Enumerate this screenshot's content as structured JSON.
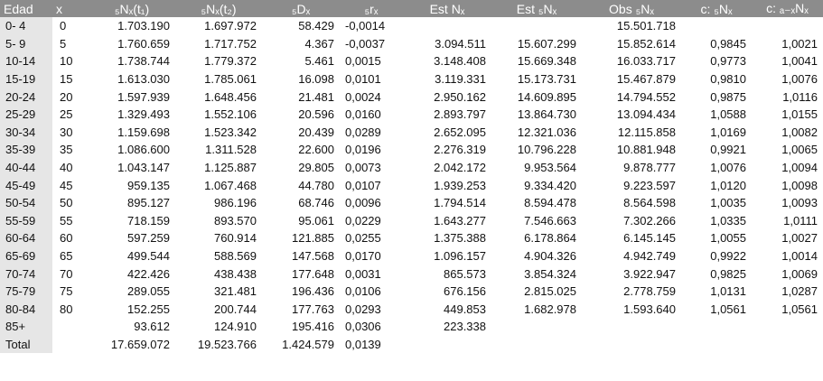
{
  "headers": [
    "Edad",
    "x",
    "₅Nₓ(t₁)",
    "₅Nₓ(t₂)",
    "₅Dₓ",
    "₅rₓ",
    "Est Nₓ",
    "Est ₅Nₓ",
    "Obs ₅Nₓ",
    "c: ₅Nₓ",
    "c: ₐ₋ₓNₓ"
  ],
  "colors": {
    "header_bg": "#8c8c8c",
    "header_text": "#ffffff",
    "label_col_bg": "#e6e6e6",
    "cell_bg": "#ffffff"
  },
  "rows": [
    [
      "0- 4",
      "0",
      "1.703.190",
      "1.697.972",
      "58.429",
      "-0,0014",
      "",
      "",
      "15.501.718",
      "",
      ""
    ],
    [
      "5- 9",
      "5",
      "1.760.659",
      "1.717.752",
      "4.367",
      "-0,0037",
      "3.094.511",
      "15.607.299",
      "15.852.614",
      "0,9845",
      "1,0021"
    ],
    [
      "10-14",
      "10",
      "1.738.744",
      "1.779.372",
      "5.461",
      "0,0015",
      "3.148.408",
      "15.669.348",
      "16.033.717",
      "0,9773",
      "1,0041"
    ],
    [
      "15-19",
      "15",
      "1.613.030",
      "1.785.061",
      "16.098",
      "0,0101",
      "3.119.331",
      "15.173.731",
      "15.467.879",
      "0,9810",
      "1,0076"
    ],
    [
      "20-24",
      "20",
      "1.597.939",
      "1.648.456",
      "21.481",
      "0,0024",
      "2.950.162",
      "14.609.895",
      "14.794.552",
      "0,9875",
      "1,0116"
    ],
    [
      "25-29",
      "25",
      "1.329.493",
      "1.552.106",
      "20.596",
      "0,0160",
      "2.893.797",
      "13.864.730",
      "13.094.434",
      "1,0588",
      "1,0155"
    ],
    [
      "30-34",
      "30",
      "1.159.698",
      "1.523.342",
      "20.439",
      "0,0289",
      "2.652.095",
      "12.321.036",
      "12.115.858",
      "1,0169",
      "1,0082"
    ],
    [
      "35-39",
      "35",
      "1.086.600",
      "1.311.528",
      "22.600",
      "0,0196",
      "2.276.319",
      "10.796.228",
      "10.881.948",
      "0,9921",
      "1,0065"
    ],
    [
      "40-44",
      "40",
      "1.043.147",
      "1.125.887",
      "29.805",
      "0,0073",
      "2.042.172",
      "9.953.564",
      "9.878.777",
      "1,0076",
      "1,0094"
    ],
    [
      "45-49",
      "45",
      "959.135",
      "1.067.468",
      "44.780",
      "0,0107",
      "1.939.253",
      "9.334.420",
      "9.223.597",
      "1,0120",
      "1,0098"
    ],
    [
      "50-54",
      "50",
      "895.127",
      "986.196",
      "68.746",
      "0,0096",
      "1.794.514",
      "8.594.478",
      "8.564.598",
      "1,0035",
      "1,0093"
    ],
    [
      "55-59",
      "55",
      "718.159",
      "893.570",
      "95.061",
      "0,0229",
      "1.643.277",
      "7.546.663",
      "7.302.266",
      "1,0335",
      "1,0111"
    ],
    [
      "60-64",
      "60",
      "597.259",
      "760.914",
      "121.885",
      "0,0255",
      "1.375.388",
      "6.178.864",
      "6.145.145",
      "1,0055",
      "1,0027"
    ],
    [
      "65-69",
      "65",
      "499.544",
      "588.569",
      "147.568",
      "0,0170",
      "1.096.157",
      "4.904.326",
      "4.942.749",
      "0,9922",
      "1,0014"
    ],
    [
      "70-74",
      "70",
      "422.426",
      "438.438",
      "177.648",
      "0,0031",
      "865.573",
      "3.854.324",
      "3.922.947",
      "0,9825",
      "1,0069"
    ],
    [
      "75-79",
      "75",
      "289.055",
      "321.481",
      "196.436",
      "0,0106",
      "676.156",
      "2.815.025",
      "2.778.759",
      "1,0131",
      "1,0287"
    ],
    [
      "80-84",
      "80",
      "152.255",
      "200.744",
      "177.763",
      "0,0293",
      "449.853",
      "1.682.978",
      "1.593.640",
      "1,0561",
      "1,0561"
    ],
    [
      "85+",
      "",
      "93.612",
      "124.910",
      "195.416",
      "0,0306",
      "223.338",
      "",
      "",
      "",
      ""
    ],
    [
      "Total",
      "",
      "17.659.072",
      "19.523.766",
      "1.424.579",
      "0,0139",
      "",
      "",
      "",
      "",
      ""
    ]
  ]
}
